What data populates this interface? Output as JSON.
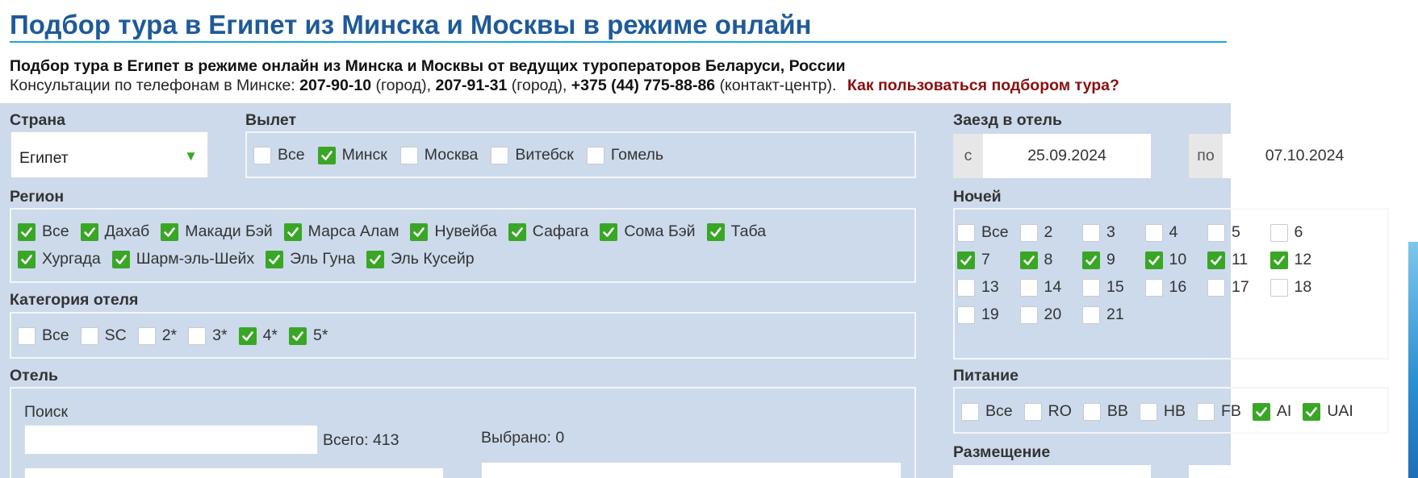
{
  "header": {
    "title": "Подбор тура в Египет из Минска и Москвы в режиме онлайн",
    "intro": "Подбор тура в Египет в режиме онлайн из Минска и Москвы от ведущих туроператоров Беларуси, России",
    "phones_prefix": "Консультации по телефонам в Минске:",
    "phone1": "207-90-10",
    "phone1_note": "(город),",
    "phone2": "207-91-31",
    "phone2_note": "(город),",
    "phone3": "+375 (44) 775-88-86",
    "phone3_note": "(контакт-центр).",
    "help_link": "Как пользоваться подбором тура?"
  },
  "country": {
    "label": "Страна",
    "value": "Египет",
    "arrow": "▼"
  },
  "departure": {
    "label": "Вылет",
    "options": [
      {
        "label": "Все",
        "checked": false
      },
      {
        "label": "Минск",
        "checked": true
      },
      {
        "label": "Москва",
        "checked": false
      },
      {
        "label": "Витебск",
        "checked": false
      },
      {
        "label": "Гомель",
        "checked": false
      }
    ]
  },
  "checkin": {
    "label": "Заезд в отель",
    "from_prefix": "с",
    "from": "25.09.2024",
    "to_prefix": "по",
    "to": "07.10.2024"
  },
  "region": {
    "label": "Регион",
    "row1": [
      {
        "label": "Все",
        "checked": true
      },
      {
        "label": "Дахаб",
        "checked": true
      },
      {
        "label": "Макади Бэй",
        "checked": true
      },
      {
        "label": "Марса Алам",
        "checked": true
      },
      {
        "label": "Нувейба",
        "checked": true
      },
      {
        "label": "Сафага",
        "checked": true
      },
      {
        "label": "Сома Бэй",
        "checked": true
      },
      {
        "label": "Таба",
        "checked": true
      }
    ],
    "row2": [
      {
        "label": "Хургада",
        "checked": true
      },
      {
        "label": "Шарм-эль-Шейх",
        "checked": true
      },
      {
        "label": "Эль Гуна",
        "checked": true
      },
      {
        "label": "Эль Кусейр",
        "checked": true
      }
    ]
  },
  "nights": {
    "label": "Ночей",
    "rows": [
      [
        {
          "label": "Все",
          "checked": false
        },
        {
          "label": "2",
          "checked": false
        },
        {
          "label": "3",
          "checked": false
        },
        {
          "label": "4",
          "checked": false
        },
        {
          "label": "5",
          "checked": false
        },
        {
          "label": "6",
          "checked": false
        }
      ],
      [
        {
          "label": "7",
          "checked": true
        },
        {
          "label": "8",
          "checked": true
        },
        {
          "label": "9",
          "checked": true
        },
        {
          "label": "10",
          "checked": true
        },
        {
          "label": "11",
          "checked": true
        },
        {
          "label": "12",
          "checked": true
        }
      ],
      [
        {
          "label": "13",
          "checked": false
        },
        {
          "label": "14",
          "checked": false
        },
        {
          "label": "15",
          "checked": false
        },
        {
          "label": "16",
          "checked": false
        },
        {
          "label": "17",
          "checked": false
        },
        {
          "label": "18",
          "checked": false
        }
      ],
      [
        {
          "label": "19",
          "checked": false
        },
        {
          "label": "20",
          "checked": false
        },
        {
          "label": "21",
          "checked": false
        }
      ]
    ]
  },
  "category": {
    "label": "Категория отеля",
    "options": [
      {
        "label": "Все",
        "checked": false
      },
      {
        "label": "SC",
        "checked": false
      },
      {
        "label": "2*",
        "checked": false
      },
      {
        "label": "3*",
        "checked": false
      },
      {
        "label": "4*",
        "checked": true
      },
      {
        "label": "5*",
        "checked": true
      }
    ]
  },
  "hotel": {
    "label": "Отель",
    "search_label": "Поиск",
    "search_value": "",
    "total": "Всего: 413",
    "selected": "Выбрано: 0"
  },
  "meals": {
    "label": "Питание",
    "options": [
      {
        "label": "Все",
        "checked": false
      },
      {
        "label": "RO",
        "checked": false
      },
      {
        "label": "BB",
        "checked": false
      },
      {
        "label": "HB",
        "checked": false
      },
      {
        "label": "FB",
        "checked": false
      },
      {
        "label": "AI",
        "checked": true
      },
      {
        "label": "UAI",
        "checked": true
      }
    ]
  },
  "accommodation": {
    "label": "Размещение"
  },
  "colors": {
    "accent": "#1f5a99",
    "check": "#3aa626",
    "panel": "#ccdaeb",
    "link": "#8b1010"
  }
}
